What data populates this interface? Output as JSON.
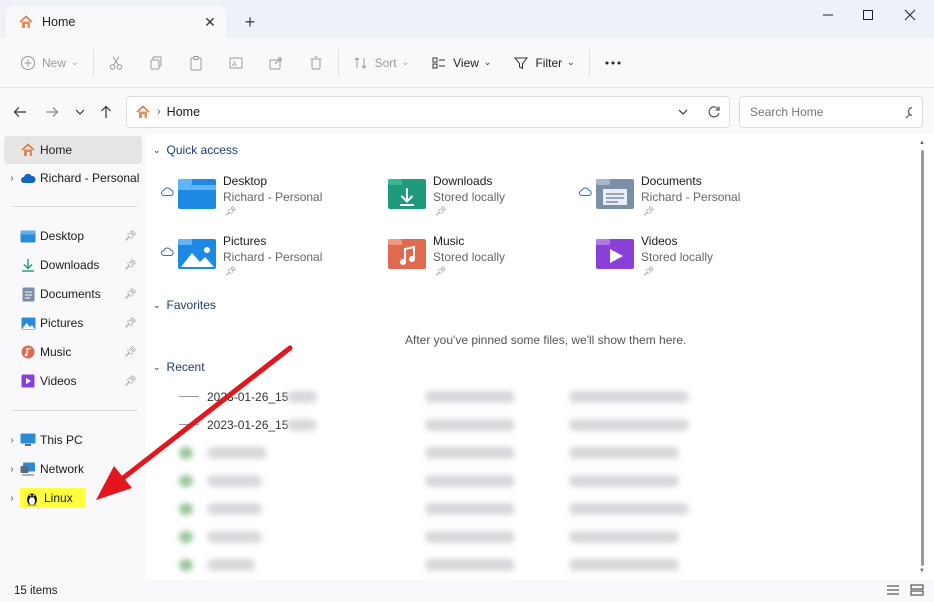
{
  "tab": {
    "title": "Home"
  },
  "toolbar": {
    "new_label": "New",
    "sort_label": "Sort",
    "view_label": "View",
    "filter_label": "Filter"
  },
  "address": {
    "crumb": "Home"
  },
  "search": {
    "placeholder": "Search Home"
  },
  "sidebar": {
    "items": [
      {
        "label": "Home"
      },
      {
        "label": "Richard - Personal"
      },
      {
        "label": "Desktop"
      },
      {
        "label": "Downloads"
      },
      {
        "label": "Documents"
      },
      {
        "label": "Pictures"
      },
      {
        "label": "Music"
      },
      {
        "label": "Videos"
      },
      {
        "label": "This PC"
      },
      {
        "label": "Network"
      },
      {
        "label": "Linux"
      }
    ]
  },
  "sections": {
    "quick_access": "Quick access",
    "favorites": "Favorites",
    "recent": "Recent"
  },
  "quick_access": [
    {
      "name": "Desktop",
      "sub": "Richard - Personal",
      "color": "#1e88e5"
    },
    {
      "name": "Downloads",
      "sub": "Stored locally",
      "color": "#1f9a7a"
    },
    {
      "name": "Documents",
      "sub": "Richard - Personal",
      "color": "#7b8fa6"
    },
    {
      "name": "Pictures",
      "sub": "Richard - Personal",
      "color": "#1e88e5"
    },
    {
      "name": "Music",
      "sub": "Stored locally",
      "color": "#e06a4f"
    },
    {
      "name": "Videos",
      "sub": "Stored locally",
      "color": "#8a3fd6"
    }
  ],
  "favorites_empty": "After you've pinned some files, we'll show them here.",
  "recent": [
    {
      "name": "2023-01-26_15"
    },
    {
      "name": "2023-01-26_15"
    }
  ],
  "status": {
    "count": "15 items"
  },
  "colors": {
    "highlight": "#ffff3d",
    "arrow": "#e3161e",
    "accent": "#1e3a6e"
  }
}
